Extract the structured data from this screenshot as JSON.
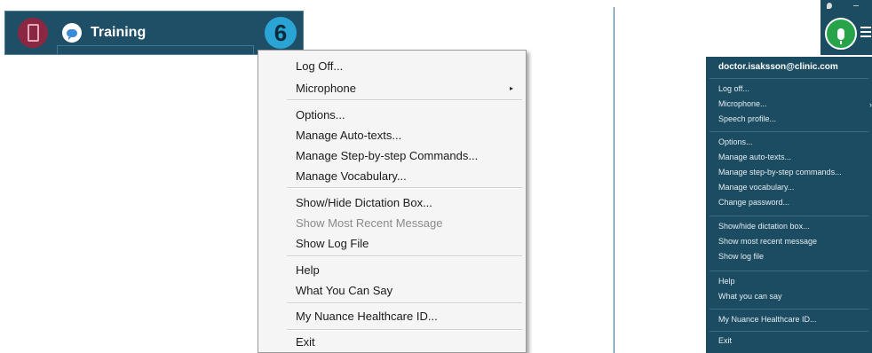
{
  "toolbar": {
    "title": "Training",
    "device_icon": "phone-icon",
    "chat_icon": "chat-bubble-icon",
    "logo_icon": "dragon-logo-icon",
    "logo_glyph": "6"
  },
  "left_menu": {
    "items": [
      {
        "label": "Log Off..."
      },
      {
        "label": "Microphone",
        "submenu_arrow": "▸"
      },
      {
        "label": "Options..."
      },
      {
        "label": "Manage Auto-texts..."
      },
      {
        "label": "Manage Step-by-step Commands..."
      },
      {
        "label": "Manage Vocabulary..."
      },
      {
        "label": "Show/Hide Dictation Box..."
      },
      {
        "label": "Show Most Recent Message",
        "disabled": true
      },
      {
        "label": "Show Log File"
      },
      {
        "label": "Help"
      },
      {
        "label": "What You Can Say"
      },
      {
        "label": "My Nuance Healthcare ID..."
      },
      {
        "label": "Exit"
      }
    ]
  },
  "right_toolbar": {
    "mic_icon": "microphone-icon",
    "menu_icon": "hamburger-menu-icon"
  },
  "right_menu": {
    "email": "doctor.isaksson@clinic.com",
    "submenu_chevron": "›",
    "items": [
      {
        "label": "Log off..."
      },
      {
        "label": "Microphone..."
      },
      {
        "label": "Speech profile..."
      },
      {
        "label": "Options..."
      },
      {
        "label": "Manage auto-texts..."
      },
      {
        "label": "Manage step-by-step commands..."
      },
      {
        "label": "Manage vocabulary..."
      },
      {
        "label": "Change password..."
      },
      {
        "label": "Show/hide dictation box..."
      },
      {
        "label": "Show most recent message"
      },
      {
        "label": "Show log file"
      },
      {
        "label": "Help"
      },
      {
        "label": "What you can say"
      },
      {
        "label": "My Nuance Healthcare ID..."
      },
      {
        "label": "Exit"
      }
    ]
  },
  "colors": {
    "toolbar_bg": "#1f4f66",
    "device_button": "#8b2740",
    "logo_blue": "#2aa4d4",
    "mic_green": "#27a34a",
    "dark_menu_bg": "#1c4c62",
    "disabled_text": "#8a8a8a"
  }
}
